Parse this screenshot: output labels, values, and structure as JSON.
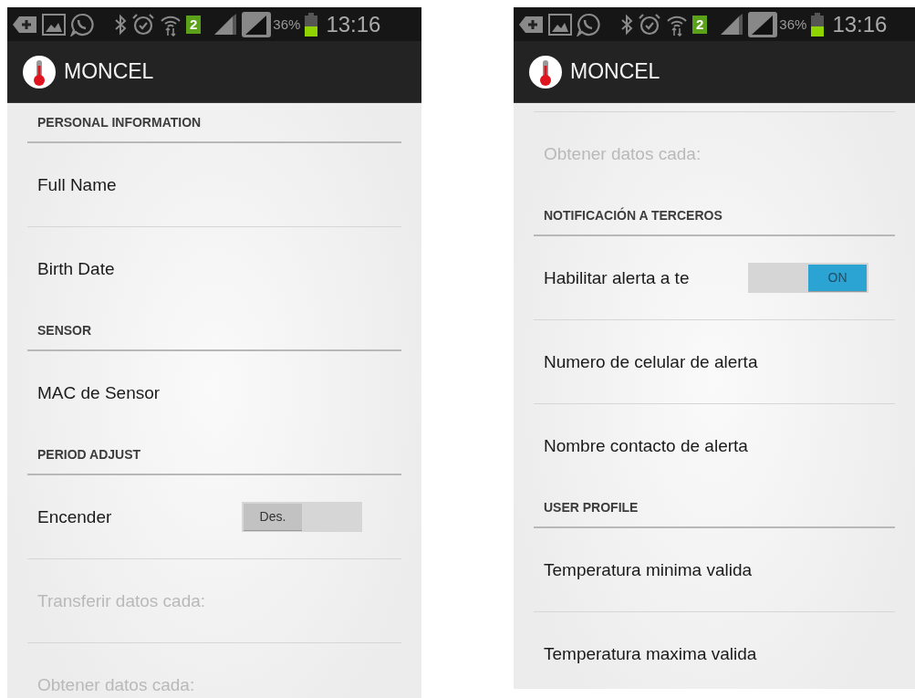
{
  "screens": [
    {
      "status_bar": {
        "sim": "2",
        "battery": "36%",
        "time": "13:16"
      },
      "app_bar": {
        "title": "MONCEL"
      },
      "top_divider": false,
      "items": [
        {
          "kind": "header",
          "title": "PERSONAL INFORMATION"
        },
        {
          "kind": "pref",
          "title": "Full Name",
          "disabled": false
        },
        {
          "kind": "pref",
          "title": "Birth Date",
          "disabled": false
        },
        {
          "kind": "header",
          "title": "SENSOR"
        },
        {
          "kind": "pref",
          "title": "MAC de Sensor",
          "disabled": false
        },
        {
          "kind": "header",
          "title": "PERIOD ADJUST"
        },
        {
          "kind": "switch",
          "title": "Encender",
          "switch_label": "Des.",
          "on": false,
          "disabled": false
        },
        {
          "kind": "pref",
          "title": "Transferir datos cada:",
          "disabled": true
        },
        {
          "kind": "pref",
          "title": "Obtener datos cada:",
          "disabled": true
        }
      ]
    },
    {
      "status_bar": {
        "sim": "2",
        "battery": "36%",
        "time": "13:16"
      },
      "app_bar": {
        "title": "MONCEL"
      },
      "top_divider": true,
      "items": [
        {
          "kind": "pref",
          "title": "Obtener datos cada:",
          "disabled": true
        },
        {
          "kind": "header",
          "title": "NOTIFICACIÓN A TERCEROS"
        },
        {
          "kind": "switch",
          "title": "Habilitar alerta a te",
          "switch_label": "ON",
          "on": true,
          "disabled": false
        },
        {
          "kind": "pref",
          "title": "Numero de celular de alerta",
          "disabled": false
        },
        {
          "kind": "pref",
          "title": "Nombre contacto de alerta",
          "disabled": false
        },
        {
          "kind": "header",
          "title": "USER PROFILE"
        },
        {
          "kind": "pref",
          "title": "Temperatura minima valida",
          "disabled": false
        },
        {
          "kind": "pref",
          "title": "Temperatura maxima valida",
          "disabled": false
        }
      ]
    }
  ]
}
